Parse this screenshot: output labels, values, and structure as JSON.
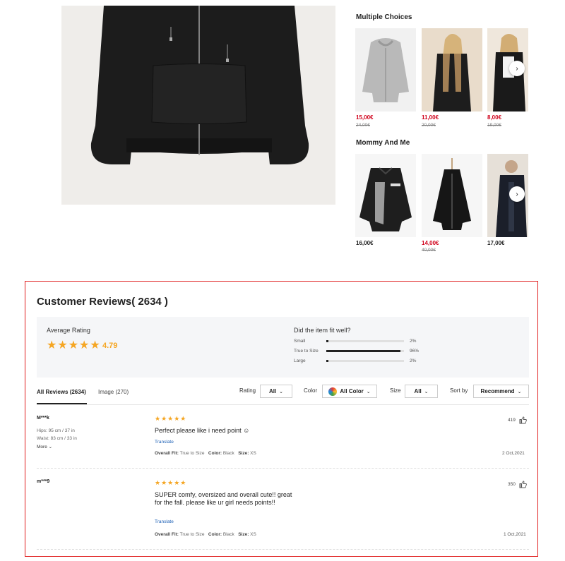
{
  "recommendations": {
    "multiple_choices": {
      "title": "Multiple Choices",
      "items": [
        {
          "price": "15,00€",
          "old_price": "24,00€"
        },
        {
          "price": "11,00€",
          "old_price": "20,00€"
        },
        {
          "price": "8,00€",
          "old_price": "19,00€"
        }
      ]
    },
    "mommy_and_me": {
      "title": "Mommy And Me",
      "items": [
        {
          "price": "16,00€",
          "old_price": ""
        },
        {
          "price": "14,00€",
          "old_price": "40,00€"
        },
        {
          "price": "17,00€",
          "old_price": ""
        }
      ]
    }
  },
  "reviews": {
    "title": "Customer Reviews( 2634 )",
    "average_label": "Average Rating",
    "average_value": "4.79",
    "fit_question": "Did the item fit well?",
    "fit": [
      {
        "label": "Small",
        "pct": "2%",
        "fraction": 0.02
      },
      {
        "label": "True to Size",
        "pct": "96%",
        "fraction": 0.96
      },
      {
        "label": "Large",
        "pct": "2%",
        "fraction": 0.02
      }
    ],
    "tabs": [
      "All Reviews (2634)",
      "Image (270)"
    ],
    "filters": {
      "rating_label": "Rating",
      "rating_value": "All",
      "color_label": "Color",
      "color_value": "All Color",
      "size_label": "Size",
      "size_value": "All",
      "sort_label": "Sort by",
      "sort_value": "Recommend"
    },
    "list": [
      {
        "user": "M***k",
        "details": [
          "Hips: 95 cm / 37 in",
          "Waist: 83 cm / 33 in"
        ],
        "more": "More",
        "stars": "★★★★★",
        "text": "Perfect please like i need point ☺",
        "translate": "Translate",
        "fit_label": "Overall Fit:",
        "fit_value": "True to Size",
        "color_label": "Color:",
        "color_value": "Black",
        "size_label": "Size:",
        "size_value": "XS",
        "date": "2 Oct,2021",
        "likes": "419"
      },
      {
        "user": "m***9",
        "details": [],
        "more": "",
        "stars": "★★★★★",
        "text": "SUPER comfy, oversized and overall cute!! great for the fall. please like ur girl needs points!!",
        "translate": "Translate",
        "fit_label": "Overall Fit:",
        "fit_value": "True to Size",
        "color_label": "Color:",
        "color_value": "Black",
        "size_label": "Size:",
        "size_value": "XS",
        "date": "1 Oct,2021",
        "likes": "350"
      }
    ]
  },
  "colors": {
    "accent_red": "#d0021b",
    "star": "#f5a623",
    "link": "#1b5fb5",
    "border": "#e01e1e"
  }
}
